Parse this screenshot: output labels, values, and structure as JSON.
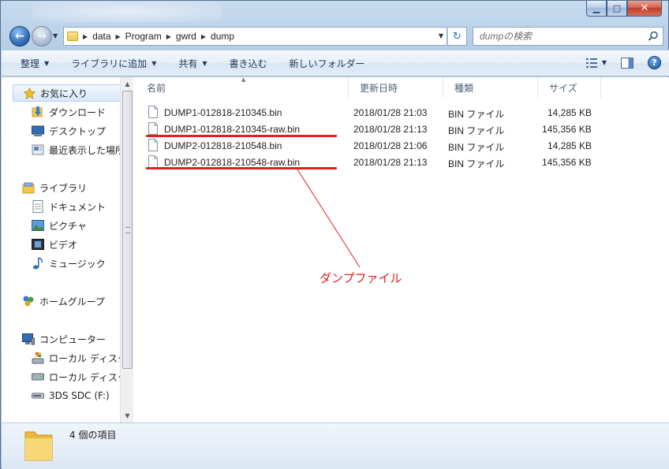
{
  "address": {
    "crumbs": [
      "data",
      "Program",
      "gwrd",
      "dump"
    ]
  },
  "search": {
    "placeholder": "dumpの検索"
  },
  "toolbar": {
    "organize": "整理",
    "add_to_library": "ライブラリに追加",
    "share": "共有",
    "burn": "書き込む",
    "new_folder": "新しいフォルダー"
  },
  "nav": {
    "favorites": "お気に入り",
    "downloads": "ダウンロード",
    "desktop": "デスクトップ",
    "recent": "最近表示した場所",
    "libraries": "ライブラリ",
    "documents": "ドキュメント",
    "pictures": "ピクチャ",
    "videos": "ビデオ",
    "music": "ミュージック",
    "homegroup": "ホームグループ",
    "computer": "コンピューター",
    "local_disk_1": "ローカル ディスク",
    "local_disk_2": "ローカル ディスク",
    "sd_card": "3DS SDC (F:)"
  },
  "columns": {
    "name": "名前",
    "date": "更新日時",
    "type": "種類",
    "size": "サイズ"
  },
  "files": [
    {
      "name": "DUMP1-012818-210345.bin",
      "date": "2018/01/28 21:03",
      "type": "BIN ファイル",
      "size": "14,285 KB"
    },
    {
      "name": "DUMP1-012818-210345-raw.bin",
      "date": "2018/01/28 21:13",
      "type": "BIN ファイル",
      "size": "145,356 KB"
    },
    {
      "name": "DUMP2-012818-210548.bin",
      "date": "2018/01/28 21:06",
      "type": "BIN ファイル",
      "size": "14,285 KB"
    },
    {
      "name": "DUMP2-012818-210548-raw.bin",
      "date": "2018/01/28 21:13",
      "type": "BIN ファイル",
      "size": "145,356 KB"
    }
  ],
  "annotation": "ダンプファイル",
  "status": {
    "item_count": "4 個の項目"
  },
  "colors": {
    "annotation_red": "#e02020",
    "toolbar_text": "#1e395b"
  }
}
